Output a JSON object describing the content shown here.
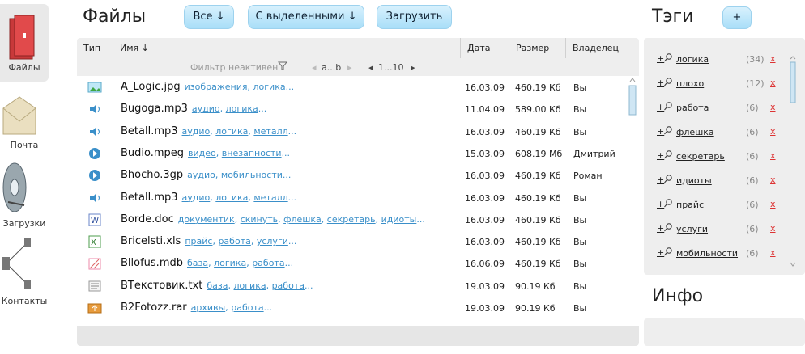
{
  "nav": [
    {
      "label": "Файлы",
      "icon": "folder-icon"
    },
    {
      "label": "Почта",
      "icon": "envelope-icon"
    },
    {
      "label": "Загрузки",
      "icon": "disk-icon"
    },
    {
      "label": "Контакты",
      "icon": "network-icon"
    }
  ],
  "header": {
    "title": "Файлы",
    "all_btn": "Все ↓",
    "selected_btn": "С выделенными ↓",
    "upload_btn": "Загрузить",
    "tags_title": "Тэги",
    "tags_add_btn": "+",
    "info_title": "Инфо"
  },
  "table": {
    "columns": {
      "type": "Тип",
      "name": "Имя ↓",
      "date": "Дата",
      "size": "Размер",
      "owner": "Владелец"
    },
    "filter": "Фильтр неактивен",
    "alpha_pager": "a...b",
    "num_pager": "1...10",
    "rows": [
      {
        "name": "A_Logic.jpg",
        "tags": [
          "изображения",
          "логика"
        ],
        "date": "16.03.09",
        "size": "460.19 Кб",
        "owner": "Вы",
        "icon": "image-icon"
      },
      {
        "name": "Bugoga.mp3",
        "tags": [
          "аудио",
          "логика"
        ],
        "date": "11.04.09",
        "size": "589.00 Кб",
        "owner": "Вы",
        "icon": "speaker-icon"
      },
      {
        "name": "Betall.mp3",
        "tags": [
          "аудио",
          "логика",
          "металл"
        ],
        "date": "16.03.09",
        "size": "460.19 Кб",
        "owner": "Вы",
        "icon": "speaker-icon"
      },
      {
        "name": "Budio.mpeg",
        "tags": [
          "видео",
          "внезапности"
        ],
        "date": "15.03.09",
        "size": "608.19 Мб",
        "owner": "Дмитрий",
        "icon": "play-icon"
      },
      {
        "name": "Bhocho.3gp",
        "tags": [
          "аудио",
          "мобильности"
        ],
        "date": "16.03.09",
        "size": "460.19 Кб",
        "owner": "Роман",
        "icon": "play-icon"
      },
      {
        "name": "Betall.mp3",
        "tags": [
          "аудио",
          "логика",
          "металл"
        ],
        "date": "16.03.09",
        "size": "460.19 Кб",
        "owner": "Вы",
        "icon": "speaker-icon"
      },
      {
        "name": "Borde.doc",
        "tags": [
          "документик",
          "скинуть",
          "флешка",
          "секретарь",
          "идиоты"
        ],
        "date": "16.03.09",
        "size": "460.19 Кб",
        "owner": "Вы",
        "icon": "word-icon"
      },
      {
        "name": "Bricelsti.xls",
        "tags": [
          "прайс",
          "работа",
          "услуги"
        ],
        "date": "16.03.09",
        "size": "460.19 Кб",
        "owner": "Вы",
        "icon": "excel-icon"
      },
      {
        "name": "Bllofus.mdb",
        "tags": [
          "база",
          "логика",
          "работа"
        ],
        "date": "16.06.09",
        "size": "460.19 Кб",
        "owner": "Вы",
        "icon": "database-icon"
      },
      {
        "name": "BТекстовик.txt",
        "tags": [
          "база",
          "логика",
          "работа"
        ],
        "date": "19.03.09",
        "size": "90.19 Кб",
        "owner": "Вы",
        "icon": "text-icon"
      },
      {
        "name": "B2Fotozz.rar",
        "tags": [
          "архивы",
          "работа"
        ],
        "date": "19.03.09",
        "size": "90.19 Кб",
        "owner": "Вы",
        "icon": "archive-icon"
      }
    ]
  },
  "tags": [
    {
      "name": "логика",
      "count": "(34)"
    },
    {
      "name": "плохо",
      "count": "(12)"
    },
    {
      "name": "работа",
      "count": "(6)"
    },
    {
      "name": "флешка",
      "count": "(6)"
    },
    {
      "name": "секретарь",
      "count": "(6)"
    },
    {
      "name": "идиоты",
      "count": "(6)"
    },
    {
      "name": "прайс",
      "count": "(6)"
    },
    {
      "name": "услуги",
      "count": "(6)"
    },
    {
      "name": "мобильности",
      "count": "(6)"
    }
  ],
  "tag_add_label": "+",
  "tag_delete_label": "x",
  "colors": {
    "accent": "#3a8fc9",
    "button": "#a9def8",
    "panel": "#eeeeee",
    "delete": "#dd3333"
  }
}
